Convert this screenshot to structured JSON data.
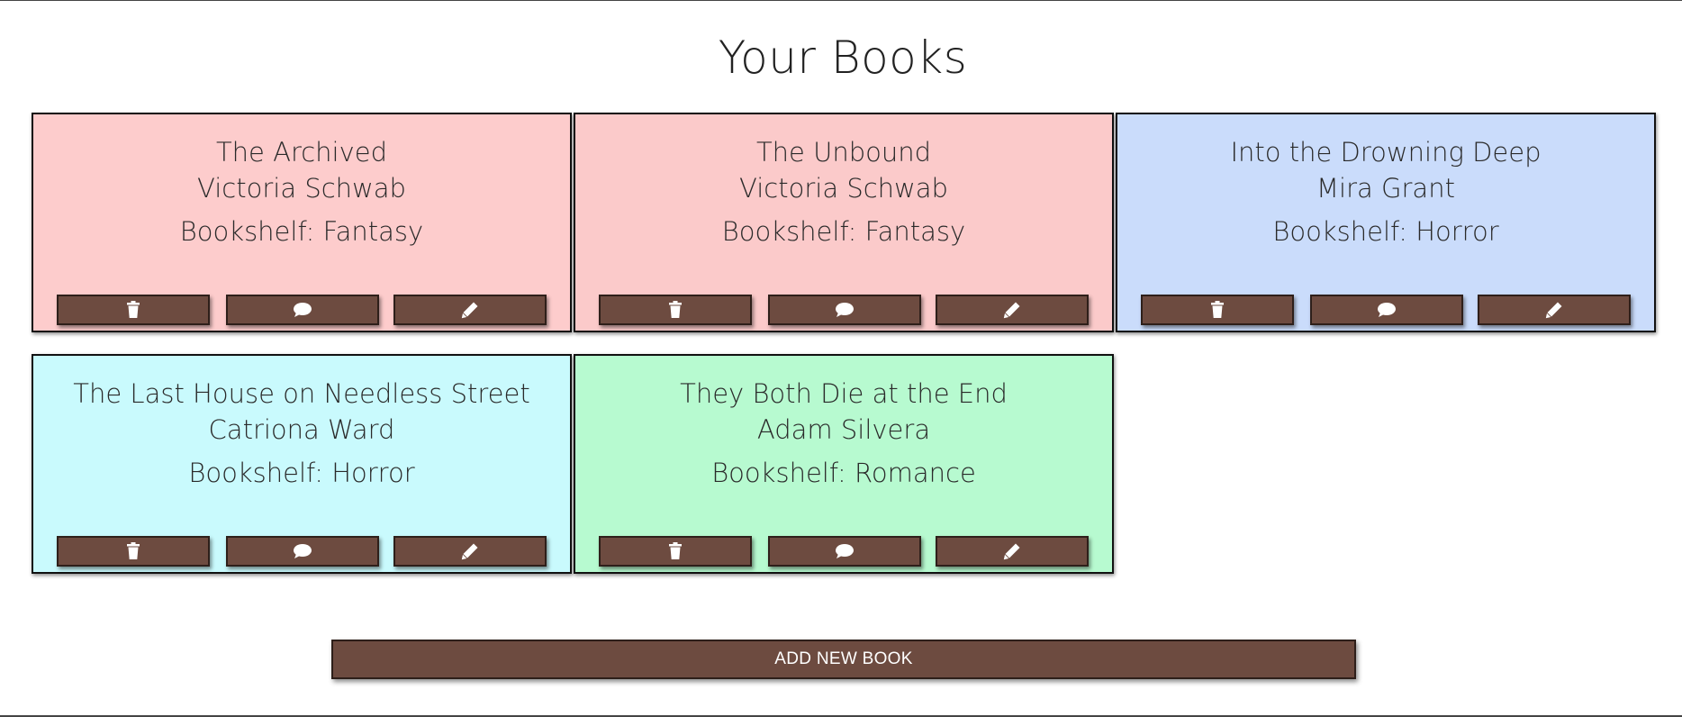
{
  "page": {
    "title": "Your Books"
  },
  "books": [
    {
      "title": "The Archived",
      "author": "Victoria Schwab",
      "bookshelf": "Bookshelf: Fantasy",
      "color": "#fdcccc"
    },
    {
      "title": "The Unbound",
      "author": "Victoria Schwab",
      "bookshelf": "Bookshelf: Fantasy",
      "color": "#fbcaca"
    },
    {
      "title": "Into the Drowning Deep",
      "author": "Mira Grant",
      "bookshelf": "Bookshelf: Horror",
      "color": "#cadcfb"
    },
    {
      "title": "The Last House on Needless Street",
      "author": "Catriona Ward",
      "bookshelf": "Bookshelf: Horror",
      "color": "#c9fafd"
    },
    {
      "title": "They Both Die at the End",
      "author": "Adam Silvera",
      "bookshelf": "Bookshelf: Romance",
      "color": "#b7fad0"
    }
  ],
  "card_actions": [
    {
      "icon": "trash-icon"
    },
    {
      "icon": "comment-icon"
    },
    {
      "icon": "pencil-icon"
    }
  ],
  "add_button": {
    "label": "ADD NEW BOOK"
  },
  "colors": {
    "button_bg": "#6d4b40",
    "button_border": "#2e1f1a"
  }
}
